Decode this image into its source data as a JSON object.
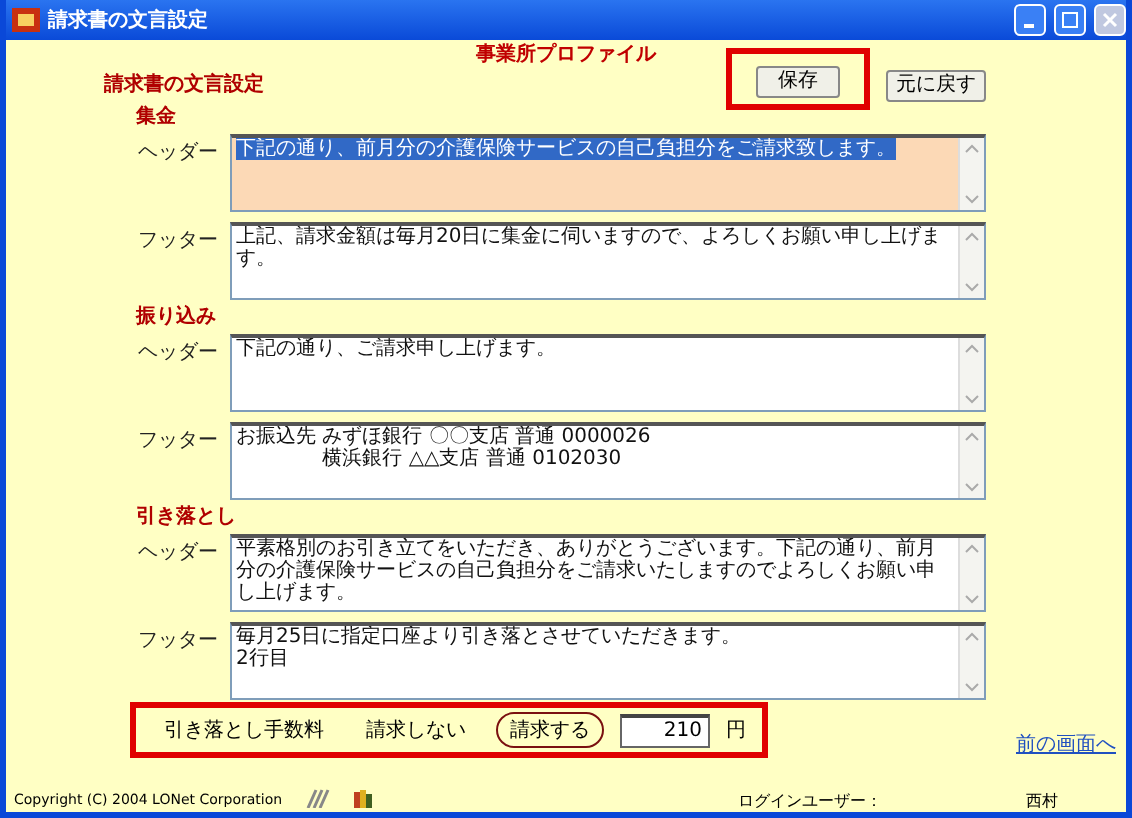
{
  "window": {
    "title": "請求書の文言設定"
  },
  "heading": "事業所プロファイル",
  "page_title": "請求書の文言設定",
  "buttons": [
    {
      "label": "保存"
    },
    {
      "label": "元に戻す"
    }
  ],
  "sections": [
    {
      "title": "集金",
      "fields": [
        {
          "label": "ヘッダー",
          "value": "下記の通り、前月分の介護保険サービスの自己負担分をご請求致します。",
          "focused": true
        },
        {
          "label": "フッター",
          "value": "上記、請求金額は毎月20日に集金に伺いますので、よろしくお願い申し上げます。",
          "focused": false
        }
      ]
    },
    {
      "title": "振り込み",
      "fields": [
        {
          "label": "ヘッダー",
          "value": "下記の通り、ご請求申し上げます。",
          "focused": false
        },
        {
          "label": "フッター",
          "value": "お振込先 みずほ銀行 〇〇支店 普通 0000026\n　　　　 横浜銀行 △△支店 普通 0102030",
          "focused": false
        }
      ]
    },
    {
      "title": "引き落とし",
      "fields": [
        {
          "label": "ヘッダー",
          "value": "平素格別のお引き立てをいただき、ありがとうございます。下記の通り、前月分の介護保険サービスの自己負担分をご請求いたしますのでよろしくお願い申し上げます。",
          "focused": false
        },
        {
          "label": "フッター",
          "value": "毎月25日に指定口座より引き落とさせていただきます。\n2行目",
          "focused": false
        }
      ]
    }
  ],
  "fee": {
    "label": "引き落とし手数料",
    "options": [
      {
        "label": "請求しない",
        "selected": false
      },
      {
        "label": "請求する",
        "selected": true
      }
    ],
    "amount": "210",
    "unit": "円"
  },
  "back_link": "前の画面へ",
  "status_bar": {
    "copyright": "Copyright (C) 2004 LONet Corporation",
    "login_label": "ログインユーザー：",
    "login_user": "西村"
  }
}
